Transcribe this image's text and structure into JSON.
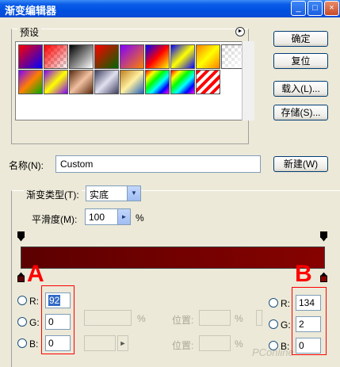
{
  "window": {
    "title": "渐变编辑器",
    "minimize_glyph": "_",
    "maximize_glyph": "□",
    "close_glyph": "×"
  },
  "presets": {
    "label": "预设",
    "menu_icon": "circle-arrow-icon"
  },
  "buttons": {
    "ok": "确定",
    "reset": "复位",
    "load": "载入(L)...",
    "save": "存储(S)...",
    "new": "新建(W)"
  },
  "name": {
    "label": "名称(N):",
    "value": "Custom"
  },
  "gradient": {
    "type_label": "渐变类型(T):",
    "type_value": "实底",
    "smooth_label": "平滑度(M):",
    "smooth_value": "100",
    "smooth_unit": "%",
    "start_color": "#5c0000",
    "end_color": "#860200"
  },
  "annotations": {
    "left_letter": "A",
    "right_letter": "B",
    "color": "#ff0000"
  },
  "left_stop": {
    "r_label": "R:",
    "r_value": "92",
    "g_label": "G:",
    "g_value": "0",
    "b_label": "B:",
    "b_value": "0"
  },
  "right_stop": {
    "r_label": "R:",
    "r_value": "134",
    "g_label": "G:",
    "g_value": "2",
    "b_label": "B:",
    "b_value": "0"
  },
  "disabled": {
    "pct1": "%",
    "pct2": "%",
    "pct3": "%",
    "location1": "位置:",
    "location2": "位置:"
  },
  "watermark": "PConline"
}
